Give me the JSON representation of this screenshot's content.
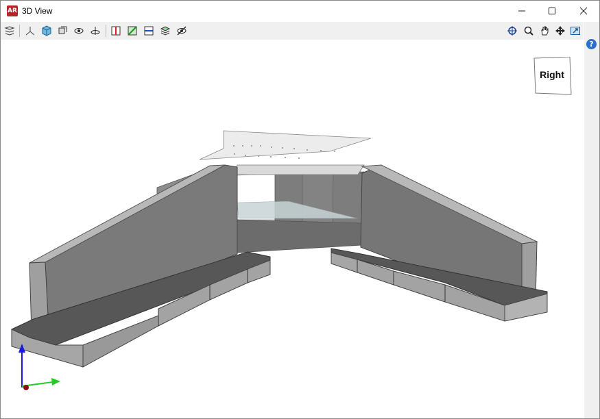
{
  "window": {
    "title": "3D View",
    "app_icon_text": "AR"
  },
  "toolbar_left": [
    {
      "name": "layers-icon"
    },
    {
      "name": "axes-icon"
    },
    {
      "name": "iso-cube-icon"
    },
    {
      "name": "orbit-view-icon"
    },
    {
      "name": "eye-rotate-icon"
    },
    {
      "name": "rotate-axis-icon"
    },
    {
      "name": "section-red-icon"
    },
    {
      "name": "section-green-icon"
    },
    {
      "name": "section-blue-icon"
    },
    {
      "name": "stacked-layers-icon"
    },
    {
      "name": "hide-eye-icon"
    }
  ],
  "toolbar_right": [
    {
      "name": "zoom-extents-icon"
    },
    {
      "name": "zoom-window-icon"
    },
    {
      "name": "pan-hand-icon"
    },
    {
      "name": "orbit-icon"
    },
    {
      "name": "export-image-icon"
    },
    {
      "name": "book-icon"
    }
  ],
  "help": {
    "text": "?"
  },
  "viewcube": {
    "label": "Right"
  },
  "colors": {
    "wall_face": "#7a7a7a",
    "wall_top": "#b5b5b5",
    "footing_top": "#575757",
    "footing_side": "#a3a3a3",
    "deck": "#ededed",
    "axis_x": "#22cc22",
    "axis_z": "#1a1ad9",
    "origin": "#8b0f0f"
  }
}
